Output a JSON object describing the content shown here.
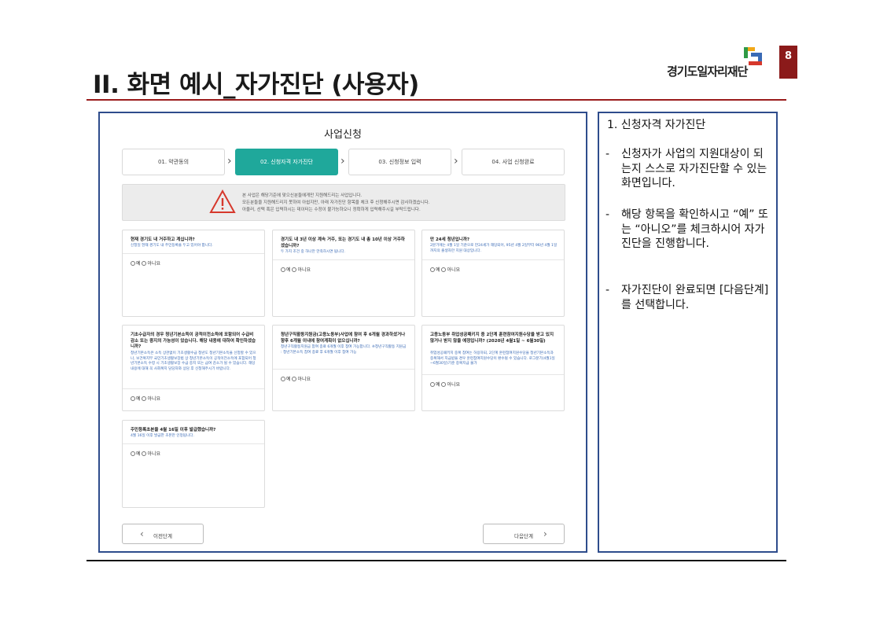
{
  "slide": {
    "title": "II. 화면 예시_자가진단 (사용자)",
    "page_number": "8",
    "logo_text": "경기도일자리재단"
  },
  "screen": {
    "title": "사업신청",
    "steps": [
      {
        "label": "01. 약관동의",
        "active": false
      },
      {
        "label": "02. 신청자격 자가진단",
        "active": true
      },
      {
        "label": "03. 신청정보 입력",
        "active": false
      },
      {
        "label": "04. 사업 신청완료",
        "active": false
      }
    ],
    "step_arrow": "›",
    "notice": {
      "lines": [
        "본 사업은 해당기준에 맞으신분들에게만 지원해드리는 사업입니다.",
        "모든분들을 지원해드리지 못하여 아쉽지만, 아래 자가진단 항목을 체크 후 신청해주시면 감사하겠습니다.",
        "아울러, 선택 혹은 입력하시는 데이터는 수정이 불가능하오니 정확하게 입력해주시길 부탁드립니다."
      ]
    },
    "option_yes": "예",
    "option_no": "아니요",
    "cards": [
      {
        "question": "현재 경기도 내 거주하고 계십니까?",
        "hint": "신청일 현재 경기도 내 주민등록을 두고 있어야 합니다."
      },
      {
        "question": "경기도 내 3년 이상 계속 거주, 또는 경기도 내 총 10년 이상 거주하셨습니까?",
        "hint": "두 가지 조건 중 하나만 만족하시면 됩니다."
      },
      {
        "question": "만 24세 청년입니까?",
        "hint": "2분기에는 4월 1일 기준으로 만24세가 해당되어, 95년 4월 2일부터 96년 4월 1일까지의 출생자만 지원 대상입니다."
      },
      {
        "question": "기초수급자의 경우 청년기본소득이 공적이전소득에 포함되어 수급비 감소 또는 중지의 가능성이 있습니다. 해당 내용에 대하여 확인하셨습니까?",
        "hint": "청년기본소득은 소득 상관없이 기초생활수급 청년도 청년기본소득을 신청할 수 있으나, 보건복지부 국민기초생활보장법 상 청년기본소득이 공적이전소득에 포함되어 청년기본소득 수령 시 기초생활보장 수급 중지 또는 급여 감소가 될 수 있습니다. 해당내용에 대해 꼭 사회복지 담당자와 상담 후 신청해주시기 바랍니다."
      },
      {
        "question": "청년구직활동지원금(고용노동부)사업에 참여 후 6개월 경과하셨거나 향후 6개월 이내에 참여계획이 없으십니까?",
        "hint": "청년구직활동지원금 참여 종료 6개월 이후 참여 가능합니다. ※청년구직활동 지원금 : 청년기본소득 참여 종료 후 6개월 이후 참여 가능"
      },
      {
        "question": "고용노동부 취업성공패키지 중 2단계 훈련참여지원수당을 받고 있지 않거나 받지 않을 예정입니까? (2020년 4월1일 ~ 6월30일)",
        "hint": "취업성공패키지 중복 참여는 허용하되, 2단계 훈련참여지원수당을 청년기본소득과 중복해서 지급받을 경우 훈련참여지원수당이 환수될 수 있습니다. 로그분기(4월1일~6월30일)기준 중복지급 불가"
      },
      {
        "question": "주민등록초본을 4월 16일 이후 발급했습니까?",
        "hint": "4월 16일 이후 발급한 초본만 인정됩니다."
      }
    ],
    "prev_button": "이전단계",
    "next_button": "다음단계"
  },
  "notes": {
    "heading": "1.  신청자격 자가진단",
    "items": [
      "신청자가 사업의 지원대상이 되는지 스스로 자가진단할 수 있는 화면입니다.",
      "해당 항목을 확인하시고 “예” 또는 “아니오”를 체크하시어 자가진단을 진행합니다.",
      "자가진단이 완료되면 [다음단계]를 선택합니다."
    ],
    "dash": "-"
  },
  "colors": {
    "accent_teal": "#1fa89b",
    "frame_blue": "#2e4c8c",
    "brand_red": "#8b1a1a",
    "hint_blue": "#3a6ab5"
  }
}
